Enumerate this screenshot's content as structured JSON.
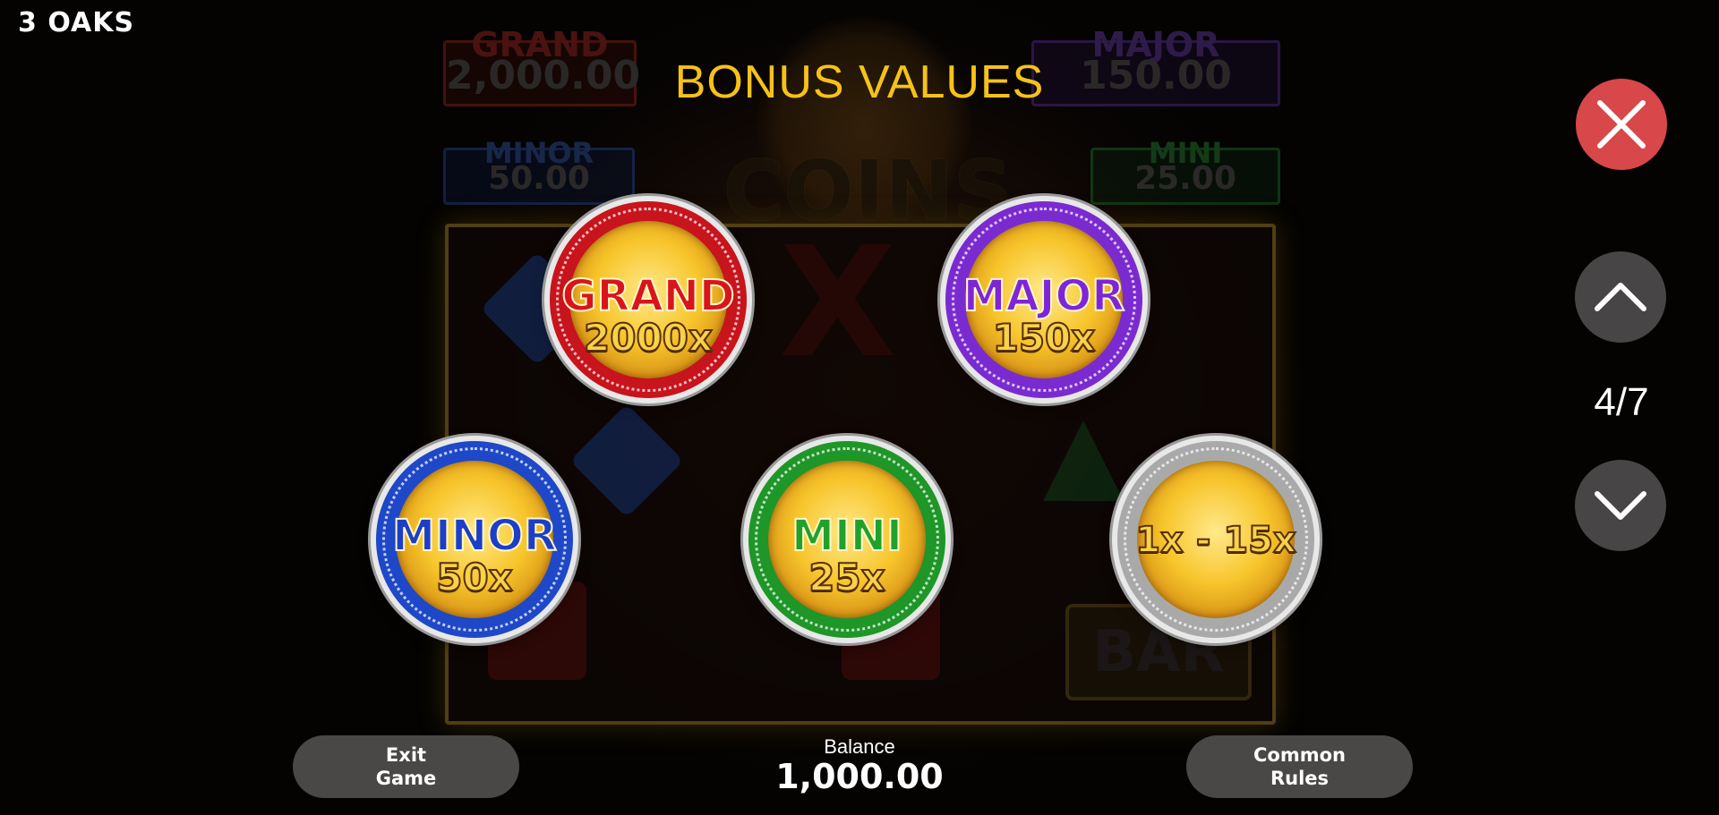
{
  "brand": "3 OAKS",
  "background": {
    "jackpots": [
      {
        "name": "GRAND",
        "value": "2,000.00"
      },
      {
        "name": "MAJOR",
        "value": "150.00"
      },
      {
        "name": "MINOR",
        "value": "50.00"
      },
      {
        "name": "MINI",
        "value": "25.00"
      }
    ],
    "logo": "COINS",
    "bar_symbol": "BAR"
  },
  "title": "BONUS VALUES",
  "coins": [
    {
      "name": "GRAND",
      "multiplier": "2000x",
      "color": "#c8141c"
    },
    {
      "name": "MAJOR",
      "multiplier": "150x",
      "color": "#7a2bd0"
    },
    {
      "name": "MINOR",
      "multiplier": "50x",
      "color": "#1e48c8"
    },
    {
      "name": "MINI",
      "multiplier": "25x",
      "color": "#1e9628"
    },
    {
      "name": "",
      "multiplier": "1x - 15x",
      "color": "#a9a9a9"
    }
  ],
  "controls": {
    "close_icon": "close-icon",
    "up_icon": "chevron-up-icon",
    "down_icon": "chevron-down-icon",
    "page": "4/7"
  },
  "footer": {
    "exit_line1": "Exit",
    "exit_line2": "Game",
    "balance_label": "Balance",
    "balance_value": "1,000.00",
    "rules_line1": "Common",
    "rules_line2": "Rules"
  },
  "colors": {
    "title": "#f6c219",
    "close_button": "#d8474a",
    "nav_button": "#474545",
    "pill_button": "#4a4747"
  }
}
